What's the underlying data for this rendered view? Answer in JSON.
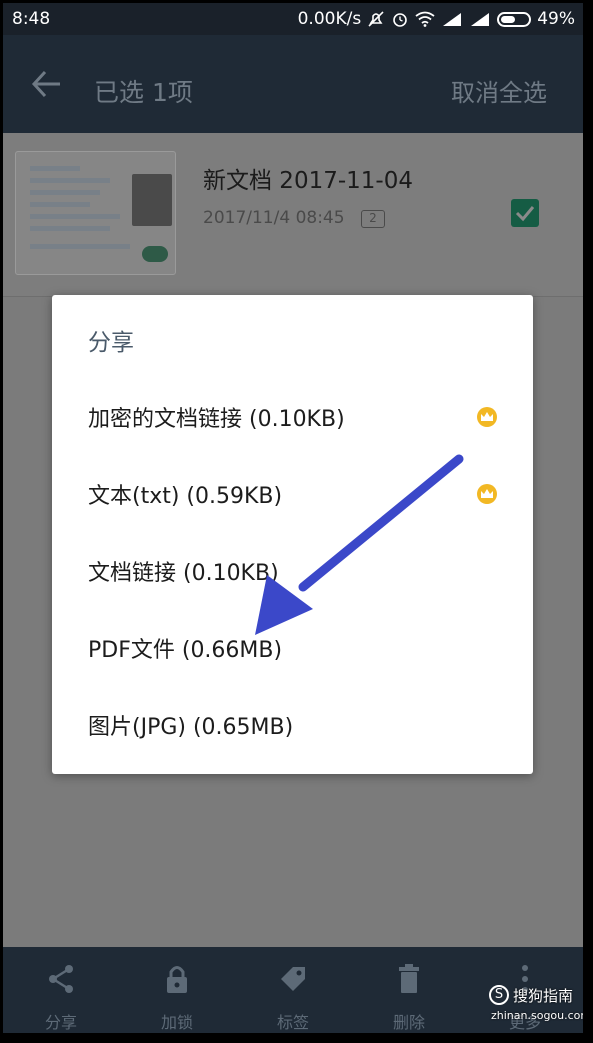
{
  "status_bar": {
    "time": "8:48",
    "net_speed": "0.00K/s",
    "battery": "49%"
  },
  "app_bar": {
    "title": "已选 1项",
    "cancel_all": "取消全选"
  },
  "document": {
    "title": "新文档 2017-11-04",
    "date": "2017/11/4 08:45",
    "pages": "2"
  },
  "share_dialog": {
    "title": "分享",
    "options": [
      {
        "label": "加密的文档链接 (0.10KB)",
        "premium": true
      },
      {
        "label": "文本(txt) (0.59KB)",
        "premium": true
      },
      {
        "label": "文档链接 (0.10KB)",
        "premium": false
      },
      {
        "label": "PDF文件 (0.66MB)",
        "premium": false
      },
      {
        "label": "图片(JPG) (0.65MB)",
        "premium": false
      }
    ]
  },
  "bottom_bar": {
    "items": [
      {
        "label": "分享",
        "icon": "share-icon"
      },
      {
        "label": "加锁",
        "icon": "lock-icon"
      },
      {
        "label": "标签",
        "icon": "tag-icon"
      },
      {
        "label": "删除",
        "icon": "trash-icon"
      },
      {
        "label": "更多",
        "icon": "more-icon"
      }
    ]
  },
  "watermark": {
    "text": "搜狗指南",
    "url": "zhinan.sogou.com"
  },
  "colors": {
    "app_bar": "#1f2a36",
    "checkbox": "#155c44",
    "crown": "#f2b824",
    "arrow": "#3b48c9"
  }
}
